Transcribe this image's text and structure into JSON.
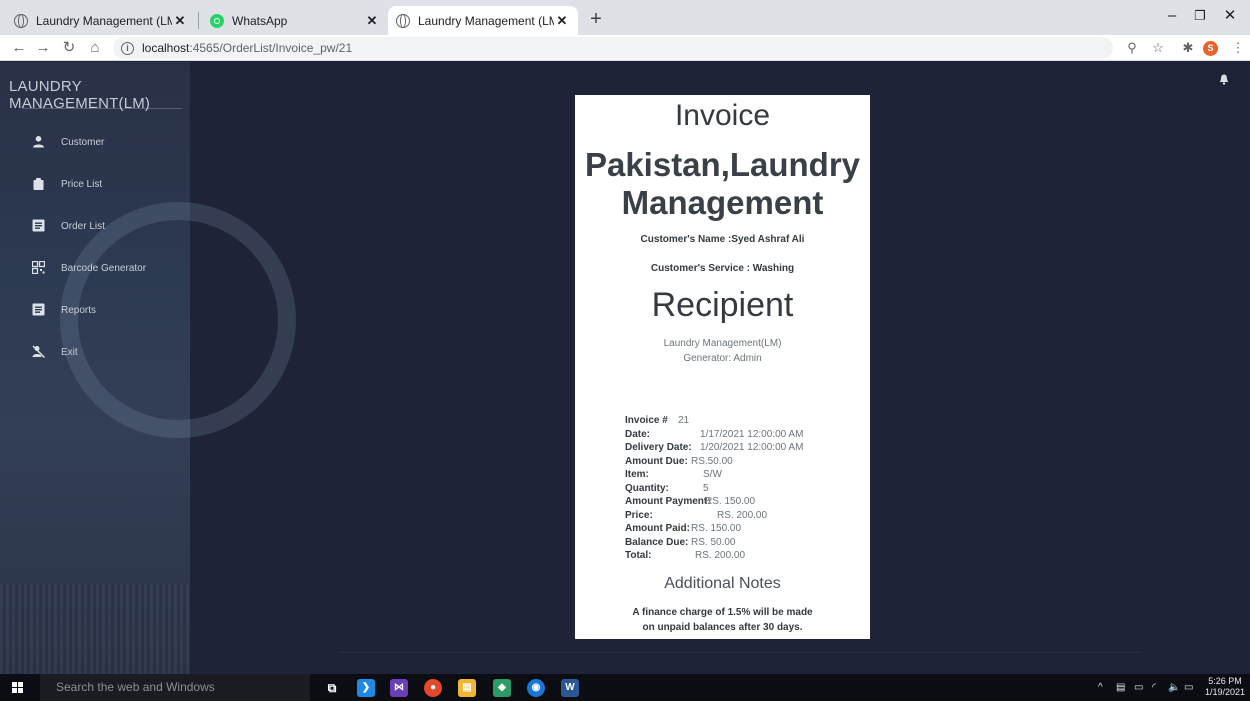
{
  "browser": {
    "tabs": [
      {
        "label": "Laundry Management (LM)!",
        "icon": "globe-icon",
        "active": false
      },
      {
        "label": "WhatsApp",
        "icon": "whatsapp-icon",
        "active": false
      },
      {
        "label": "Laundry Management (LM)!",
        "icon": "globe-icon",
        "active": true
      }
    ],
    "url_host": "localhost",
    "url_path": ":4565/OrderList/Invoice_pw/21",
    "profile_initial": "S"
  },
  "sidebar": {
    "brand": "LAUNDRY MANAGEMENT(LM)",
    "items": [
      {
        "label": "Customer",
        "icon": "person-icon"
      },
      {
        "label": "Price List",
        "icon": "clipboard-icon"
      },
      {
        "label": "Order List",
        "icon": "list-icon"
      },
      {
        "label": "Barcode Generator",
        "icon": "qr-icon"
      },
      {
        "label": "Reports",
        "icon": "report-icon"
      },
      {
        "label": "Exit",
        "icon": "exit-icon"
      }
    ]
  },
  "invoice": {
    "title": "Invoice",
    "company_line1": "Pakistan,Laundry",
    "company_line2": "Management",
    "customer_name": "Customer's Name :Syed Ashraf Ali",
    "customer_service": "Customer's Service : Washing",
    "recipient_heading": "Recipient",
    "recipient_org": "Laundry Management(LM)",
    "recipient_generator": "Generator: Admin",
    "details": [
      {
        "label": "Invoice #",
        "value": "21"
      },
      {
        "label": "Date:",
        "value": "1/17/2021 12:00:00 AM"
      },
      {
        "label": "Delivery Date:",
        "value": "1/20/2021 12:00:00 AM"
      },
      {
        "label": "Amount Due:",
        "value": "RS.50.00"
      },
      {
        "label": "Item:",
        "value": "S/W"
      },
      {
        "label": "Quantity:",
        "value": "5"
      },
      {
        "label": "Amount Payment:",
        "value": "RS. 150.00"
      },
      {
        "label": "Price:",
        "value": "RS. 200.00"
      },
      {
        "label": "Amount Paid:",
        "value": "RS. 150.00"
      },
      {
        "label": "Balance Due:",
        "value": "RS. 50.00"
      },
      {
        "label": "Total:",
        "value": "RS. 200.00"
      }
    ],
    "notes_heading": "Additional Notes",
    "notes_line1": "A finance charge of 1.5% will be made",
    "notes_line2": "on unpaid balances after 30 days."
  },
  "taskbar": {
    "search_placeholder": "Search the web and Windows",
    "time": "5:26 PM",
    "date": "1/19/2021"
  },
  "colors": {
    "page_bg": "#1f2338",
    "sidebar_bg": "#2c3a52",
    "card_bg": "#ffffff",
    "heading_text": "#343a40"
  }
}
